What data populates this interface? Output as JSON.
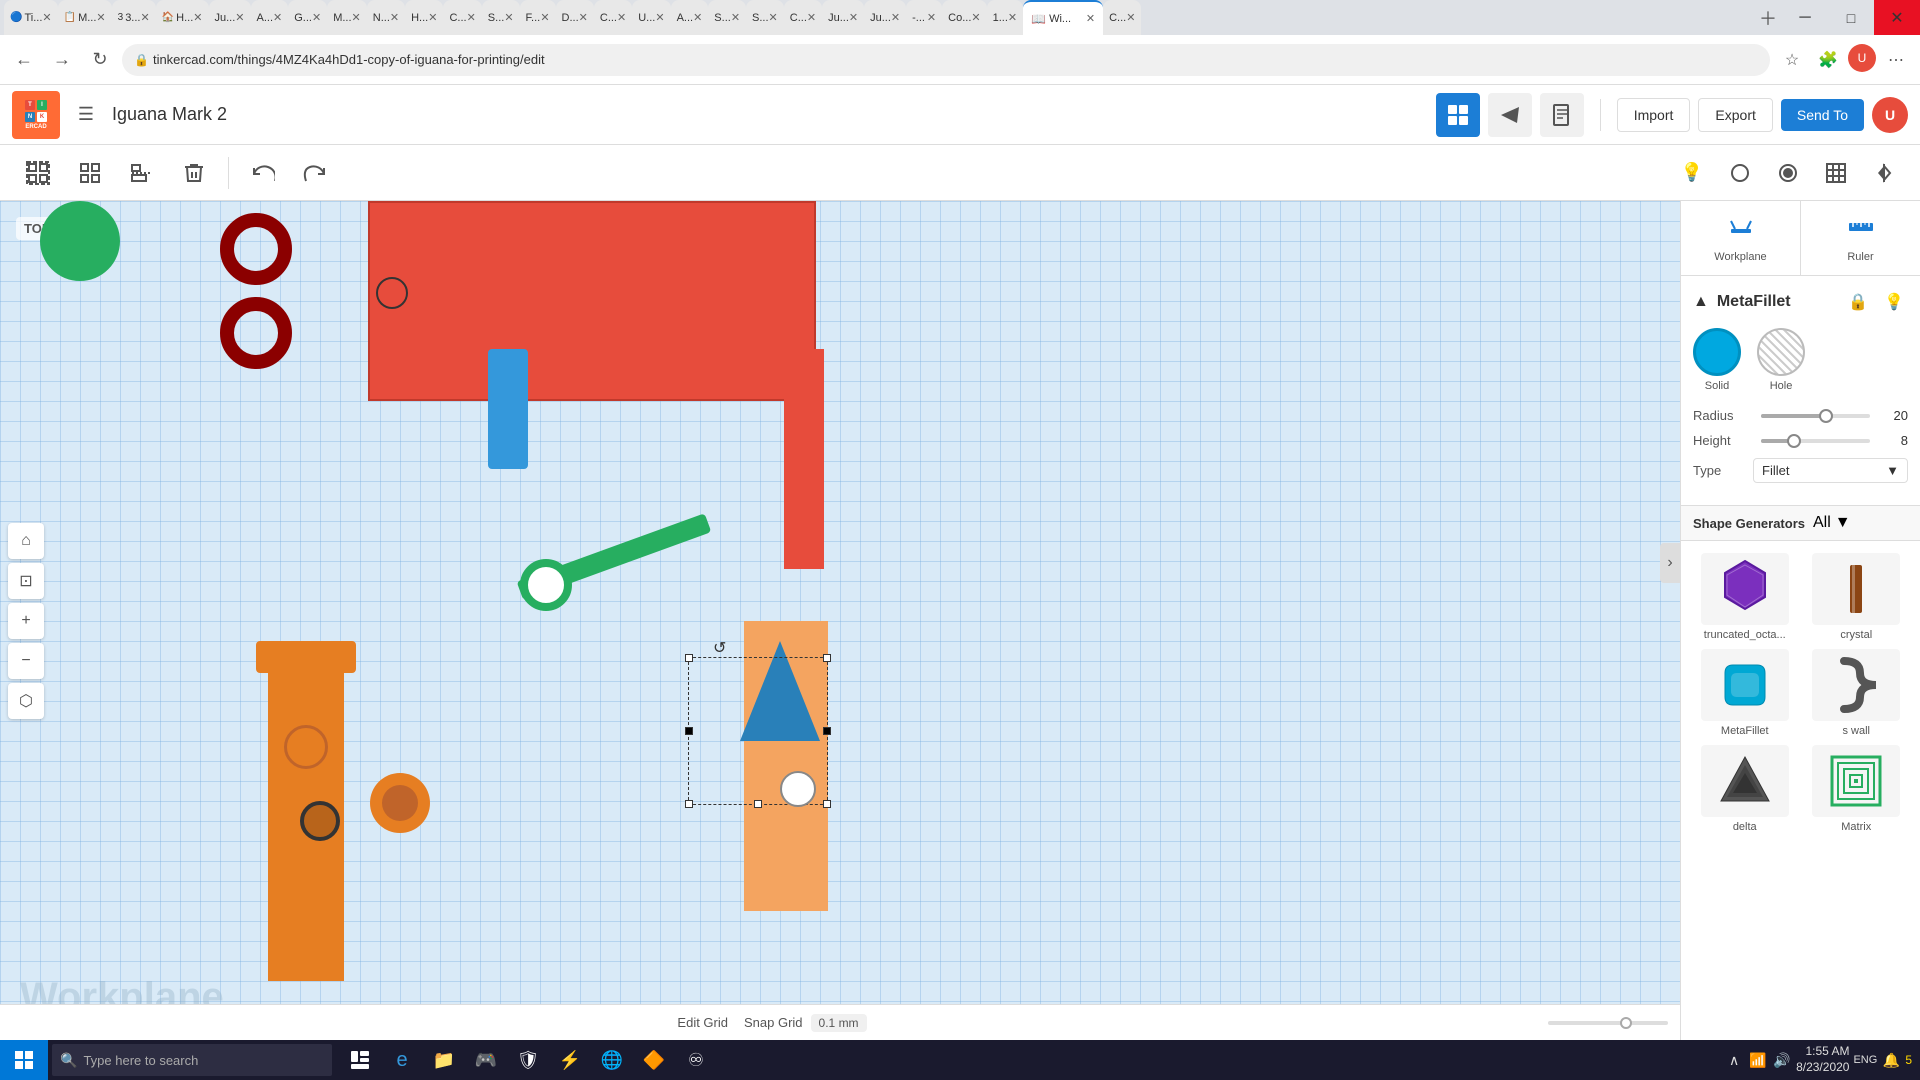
{
  "browser": {
    "address": "tinkercad.com/things/4MZ4Ka4hDd1-copy-of-iguana-for-printing/edit",
    "tabs": [
      {
        "label": "Ti",
        "title": "Ti...",
        "favicon": "🔵"
      },
      {
        "label": "M",
        "title": "M...",
        "favicon": "📋"
      },
      {
        "label": "3",
        "title": "3...",
        "favicon": "3"
      },
      {
        "label": "H",
        "title": "H...",
        "favicon": "🏠"
      },
      {
        "label": "Ju",
        "title": "Ju...",
        "favicon": "👤"
      },
      {
        "label": "A",
        "title": "A...",
        "favicon": "▶"
      },
      {
        "label": "G",
        "title": "G...",
        "favicon": "✉"
      },
      {
        "label": "M",
        "title": "M...",
        "favicon": "📧"
      },
      {
        "label": "N",
        "title": "N...",
        "favicon": "📰"
      },
      {
        "label": "H",
        "title": "H...",
        "favicon": "⚡"
      },
      {
        "label": "C",
        "title": "C...",
        "favicon": "🔵"
      },
      {
        "label": "S",
        "title": "S...",
        "favicon": "🔒"
      },
      {
        "label": "F",
        "title": "F...",
        "favicon": "🔥"
      },
      {
        "label": "D",
        "title": "D...",
        "favicon": "📊"
      },
      {
        "label": "C",
        "title": "C...",
        "favicon": "🎵"
      },
      {
        "label": "U",
        "title": "U...",
        "favicon": "🌐"
      },
      {
        "label": "A",
        "title": "A...",
        "favicon": "🅰"
      },
      {
        "label": "S",
        "title": "S...",
        "favicon": "🖥"
      },
      {
        "label": "S",
        "title": "S...",
        "favicon": "📱"
      },
      {
        "label": "C",
        "title": "C...",
        "favicon": "⚙"
      },
      {
        "label": "Ju",
        "title": "Ju...",
        "favicon": "👤"
      },
      {
        "label": "Ju",
        "title": "Ju...",
        "favicon": "👤"
      },
      {
        "label": "-",
        "title": "-...",
        "favicon": "❓"
      },
      {
        "label": "Co",
        "title": "Co...",
        "favicon": "💻"
      },
      {
        "label": "1",
        "title": "1...",
        "favicon": "1"
      },
      {
        "label": "Wi",
        "title": "Wi...",
        "favicon": "📖"
      },
      {
        "label": "C",
        "title": "C...",
        "favicon": "🎮"
      },
      {
        "label": "+",
        "title": "new tab",
        "favicon": "+"
      }
    ],
    "active_tab": "Wi"
  },
  "tinkercad": {
    "project_name": "Iguana Mark 2",
    "header": {
      "import_label": "Import",
      "export_label": "Export",
      "sendto_label": "Send To"
    },
    "toolbar": {
      "group_label": "Group",
      "ungroup_label": "Ungroup",
      "align_label": "Align",
      "delete_label": "Delete",
      "undo_label": "Undo",
      "redo_label": "Redo"
    },
    "canvas": {
      "view_label": "TOP"
    },
    "workplane_btn": "Workplane",
    "ruler_btn": "Ruler",
    "properties": {
      "title": "MetaFillet",
      "solid_label": "Solid",
      "hole_label": "Hole",
      "radius_label": "Radius",
      "radius_value": "20",
      "radius_pct": "60",
      "height_label": "Height",
      "height_value": "8",
      "height_pct": "30",
      "type_label": "Type",
      "type_value": "Fillet"
    },
    "shape_generators": {
      "title": "Shape Generators",
      "filter": "All",
      "items": [
        {
          "name": "truncated_octa...",
          "type": "truncated_oct"
        },
        {
          "name": "crystal",
          "type": "crystal"
        },
        {
          "name": "MetaFillet",
          "type": "metafillet"
        },
        {
          "name": "s wall",
          "type": "swall"
        },
        {
          "name": "delta",
          "type": "delta"
        },
        {
          "name": "Matrix",
          "type": "matrix"
        }
      ]
    },
    "bottom": {
      "edit_grid_label": "Edit Grid",
      "snap_grid_label": "Snap Grid",
      "snap_value": "0.1 mm"
    }
  },
  "taskbar": {
    "search_placeholder": "Type here to search",
    "time": "1:55 AM",
    "date": "8/23/2020",
    "language": "ENG"
  }
}
